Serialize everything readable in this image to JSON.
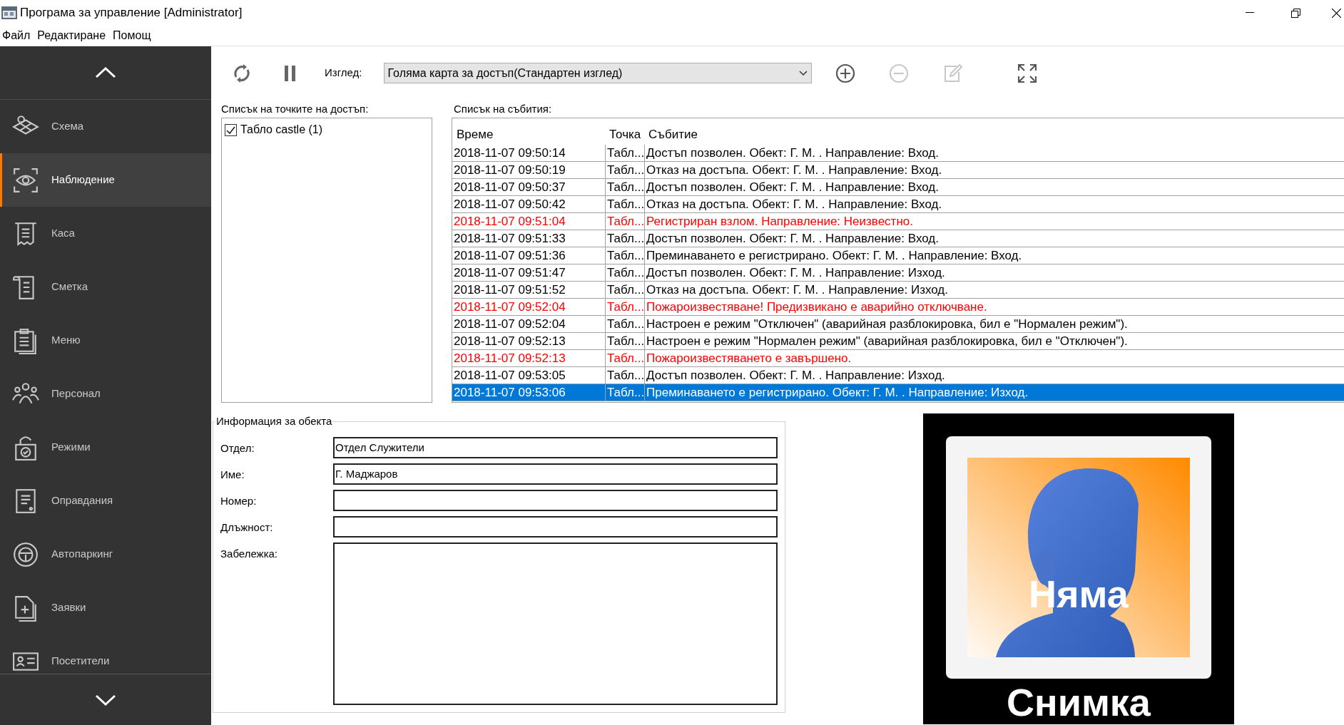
{
  "window": {
    "title": "Програма за управление [Administrator]"
  },
  "menu": [
    "Файл",
    "Редактиране",
    "Помощ"
  ],
  "sidebar": {
    "items": [
      {
        "label": "Схема",
        "selected": false
      },
      {
        "label": "Наблюдение",
        "selected": true
      },
      {
        "label": "Каса",
        "selected": false
      },
      {
        "label": "Сметка",
        "selected": false
      },
      {
        "label": "Меню",
        "selected": false
      },
      {
        "label": "Персонал",
        "selected": false
      },
      {
        "label": "Режими",
        "selected": false
      },
      {
        "label": "Оправдания",
        "selected": false
      },
      {
        "label": "Автопаркинг",
        "selected": false
      },
      {
        "label": "Заявки",
        "selected": false
      },
      {
        "label": "Посетители",
        "selected": false
      }
    ]
  },
  "toolbar": {
    "view_label": "Изглед:",
    "view_value": "Голяма карта за достъп(Стандартен изглед)",
    "remove_disabled": true,
    "edit_disabled": true
  },
  "access_points": {
    "title": "Списък на точките на достъп:",
    "items": [
      {
        "label": "Табло castle (1)",
        "checked": true
      }
    ]
  },
  "events": {
    "title": "Списък на събития:",
    "columns": [
      "Време",
      "Точка",
      "Събитие"
    ],
    "rows": [
      {
        "time": "2018-11-07 09:50:14",
        "point": "Табл...",
        "event": "Достъп позволен. Обект: Г. М. . Направление: Вход.",
        "alarm": false,
        "selected": false
      },
      {
        "time": "2018-11-07 09:50:19",
        "point": "Табл...",
        "event": "Отказ на достъпа. Обект: Г. М. . Направление: Вход.",
        "alarm": false,
        "selected": false
      },
      {
        "time": "2018-11-07 09:50:37",
        "point": "Табл...",
        "event": "Достъп позволен. Обект: Г. М. . Направление: Вход.",
        "alarm": false,
        "selected": false
      },
      {
        "time": "2018-11-07 09:50:42",
        "point": "Табл...",
        "event": "Отказ на достъпа. Обект: Г. М. . Направление: Вход.",
        "alarm": false,
        "selected": false
      },
      {
        "time": "2018-11-07 09:51:04",
        "point": "Табл...",
        "event": "Регистриран взлом. Направление: Неизвестно.",
        "alarm": true,
        "selected": false
      },
      {
        "time": "2018-11-07 09:51:33",
        "point": "Табл...",
        "event": "Достъп позволен. Обект: Г. М. . Направление: Вход.",
        "alarm": false,
        "selected": false
      },
      {
        "time": "2018-11-07 09:51:36",
        "point": "Табл...",
        "event": "Преминаването е регистрирано. Обект: Г. М. . Направление: Вход.",
        "alarm": false,
        "selected": false
      },
      {
        "time": "2018-11-07 09:51:47",
        "point": "Табл...",
        "event": "Достъп позволен. Обект: Г. М. . Направление: Изход.",
        "alarm": false,
        "selected": false
      },
      {
        "time": "2018-11-07 09:51:52",
        "point": "Табл...",
        "event": "Отказ на достъпа. Обект: Г. М. . Направление: Изход.",
        "alarm": false,
        "selected": false
      },
      {
        "time": "2018-11-07 09:52:04",
        "point": "Табл...",
        "event": "Пожароизвестяване! Предизвикано е аварийно отключване.",
        "alarm": true,
        "selected": false
      },
      {
        "time": "2018-11-07 09:52:04",
        "point": "Табл...",
        "event": "Настроен е режим \"Отключен\" (аварийная разблокировка, бил е \"Нормален режим\").",
        "alarm": false,
        "selected": false
      },
      {
        "time": "2018-11-07 09:52:13",
        "point": "Табл...",
        "event": "Настроен е режим \"Нормален режим\" (аварийная разблокировка, бил е \"Отключен\").",
        "alarm": false,
        "selected": false
      },
      {
        "time": "2018-11-07 09:52:13",
        "point": "Табл...",
        "event": "Пожароизвестяването е завършено.",
        "alarm": true,
        "selected": false
      },
      {
        "time": "2018-11-07 09:53:05",
        "point": "Табл...",
        "event": "Достъп позволен. Обект: Г. М. . Направление: Изход.",
        "alarm": false,
        "selected": false
      },
      {
        "time": "2018-11-07 09:53:06",
        "point": "Табл...",
        "event": "Преминаването е регистрирано. Обект: Г. М. . Направление: Изход.",
        "alarm": false,
        "selected": true
      }
    ]
  },
  "object_info": {
    "title": "Информация за обекта",
    "fields": [
      {
        "label": "Отдел:",
        "value": "Отдел Служители",
        "kind": "line"
      },
      {
        "label": "Име:",
        "value": "Г. Маджаров",
        "kind": "line"
      },
      {
        "label": "Номер:",
        "kind": "line"
      },
      {
        "label": "Длъжност:",
        "kind": "line"
      },
      {
        "label": "Забележка:",
        "kind": "area"
      }
    ]
  },
  "photo": {
    "caption_line_1": "Няма",
    "caption_line_2": "Снимка"
  }
}
